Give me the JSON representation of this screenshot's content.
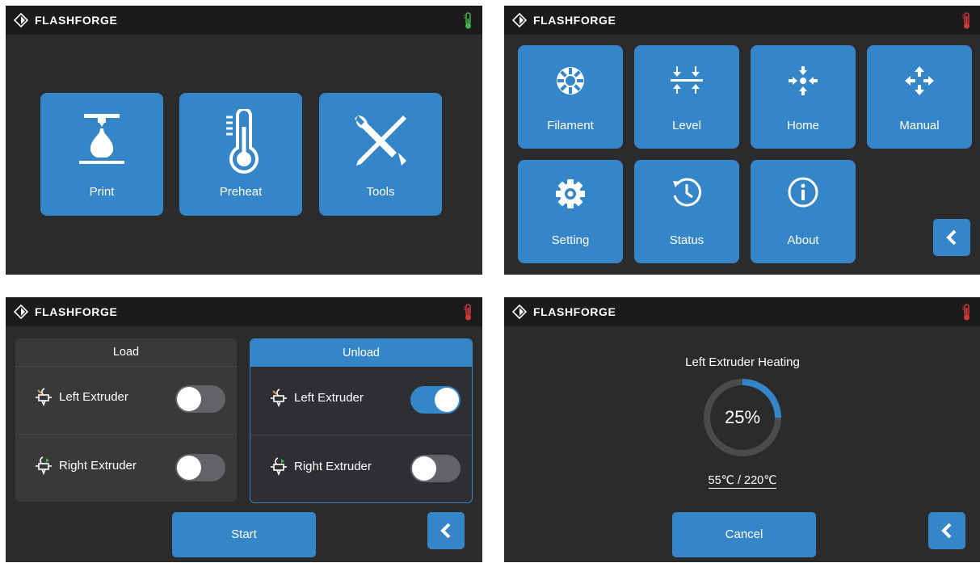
{
  "brand": "FLASHFORGE",
  "colors": {
    "accent": "#3586c9",
    "screen_bg": "#2b2b2c",
    "topbar_bg": "#1b1b1c",
    "thermo_ok": "#3fb54a",
    "thermo_hot": "#d23a3a"
  },
  "screen_home": {
    "thermo_icon": "thermometer-green-icon",
    "tiles": [
      {
        "label": "Print",
        "icon": "print-icon"
      },
      {
        "label": "Preheat",
        "icon": "thermometer-icon"
      },
      {
        "label": "Tools",
        "icon": "tools-icon"
      }
    ]
  },
  "screen_tools": {
    "thermo_icon": "thermometer-red-icon",
    "tiles": [
      {
        "label": "Filament",
        "icon": "filament-icon"
      },
      {
        "label": "Level",
        "icon": "level-icon"
      },
      {
        "label": "Home",
        "icon": "home-axes-icon"
      },
      {
        "label": "Manual",
        "icon": "manual-move-icon"
      },
      {
        "label": "Setting",
        "icon": "gear-icon"
      },
      {
        "label": "Status",
        "icon": "clock-icon"
      },
      {
        "label": "About",
        "icon": "info-icon"
      }
    ],
    "back_icon": "back-chevron-icon"
  },
  "screen_filament": {
    "load": {
      "title": "Load",
      "rows": [
        {
          "label": "Left Extruder",
          "on": false
        },
        {
          "label": "Right Extruder",
          "on": false
        }
      ]
    },
    "unload": {
      "title": "Unload",
      "rows": [
        {
          "label": "Left Extruder",
          "on": true
        },
        {
          "label": "Right Extruder",
          "on": false
        }
      ]
    },
    "start_label": "Start",
    "back_icon": "back-chevron-icon"
  },
  "screen_heating": {
    "title": "Left Extruder Heating",
    "percent_text": "25%",
    "progress": 0.25,
    "temps": "55℃ / 220℃",
    "cancel_label": "Cancel",
    "back_icon": "back-chevron-icon"
  }
}
